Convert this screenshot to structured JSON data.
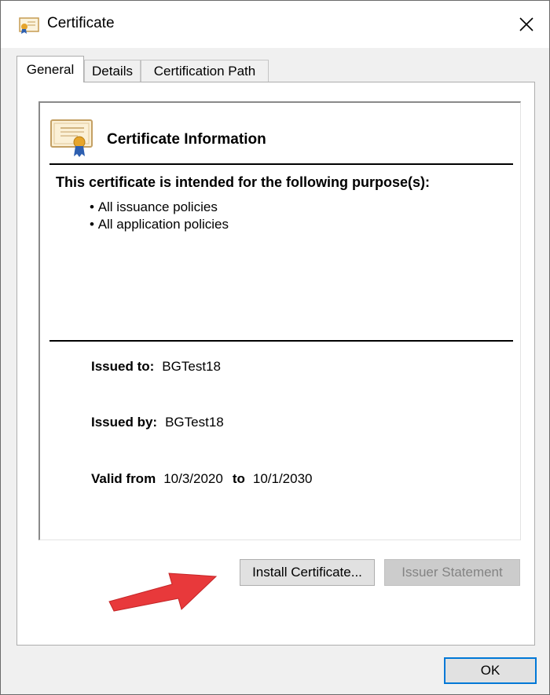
{
  "window": {
    "title": "Certificate",
    "close_glyph": "✕"
  },
  "tabs": [
    {
      "label": "General",
      "active": true
    },
    {
      "label": "Details",
      "active": false
    },
    {
      "label": "Certification Path",
      "active": false
    }
  ],
  "certificate": {
    "info_title": "Certificate Information",
    "purpose_heading": "This certificate is intended for the following purpose(s):",
    "purposes": [
      "All issuance policies",
      "All application policies"
    ],
    "issued_to_label": "Issued to:",
    "issued_to": "BGTest18",
    "issued_by_label": "Issued by:",
    "issued_by": "BGTest18",
    "valid_from_label": "Valid from",
    "valid_from": "10/3/2020",
    "valid_to_label": "to",
    "valid_to": "10/1/2030"
  },
  "buttons": {
    "install": "Install Certificate...",
    "issuer_statement": "Issuer Statement",
    "ok": "OK"
  },
  "icons": {
    "title_icon": "certificate-icon",
    "cert_icon": "certificate-icon",
    "close_icon": "close-icon",
    "annotation": "red-arrow-icon"
  },
  "colors": {
    "accent_focus": "#0078d7",
    "annotation_arrow": "#e8393b",
    "seal": "#e6a52c"
  }
}
